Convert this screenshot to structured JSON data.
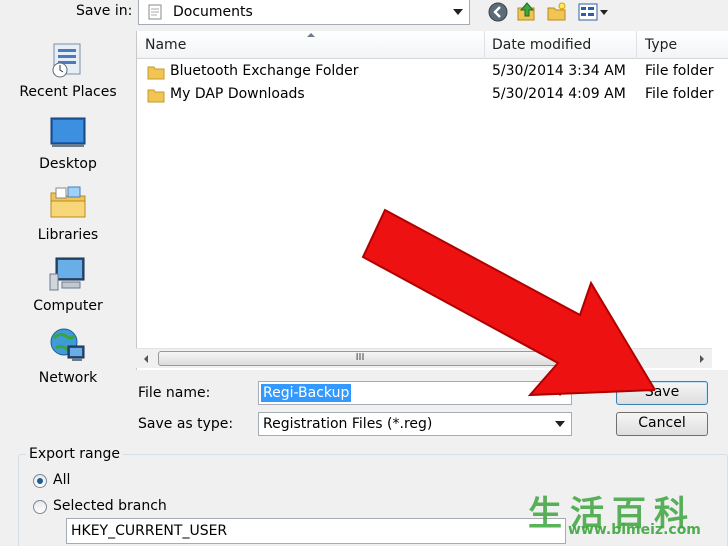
{
  "top_bar": {
    "save_in_label": "Save in:",
    "save_in_value": "Documents"
  },
  "places": [
    {
      "label": "Recent Places",
      "icon": "recent-places-icon"
    },
    {
      "label": "Desktop",
      "icon": "desktop-icon"
    },
    {
      "label": "Libraries",
      "icon": "libraries-icon"
    },
    {
      "label": "Computer",
      "icon": "computer-icon"
    },
    {
      "label": "Network",
      "icon": "network-icon"
    }
  ],
  "file_list": {
    "columns": [
      "Name",
      "Date modified",
      "Type"
    ],
    "rows": [
      {
        "name": "Bluetooth Exchange Folder",
        "date": "5/30/2014 3:34 AM",
        "type": "File folder"
      },
      {
        "name": "My DAP Downloads",
        "date": "5/30/2014 4:09 AM",
        "type": "File folder"
      }
    ],
    "scroll_grip": "III"
  },
  "form": {
    "file_name_label": "File name:",
    "file_name_value": "Regi-Backup",
    "save_as_type_label": "Save as type:",
    "save_as_type_value": "Registration Files (*.reg)",
    "save_button": "Save",
    "cancel_button": "Cancel"
  },
  "export_range": {
    "legend": "Export range",
    "option_all": "All",
    "option_selected": "Selected branch",
    "branch_value": "HKEY_CURRENT_USER",
    "selected": "All"
  },
  "watermark": {
    "chars": "生活百科",
    "url": "www.bimeiz.com"
  },
  "colors": {
    "arrow": "#ee1111",
    "selection": "#3399ff",
    "watermark": "#3da63d"
  }
}
